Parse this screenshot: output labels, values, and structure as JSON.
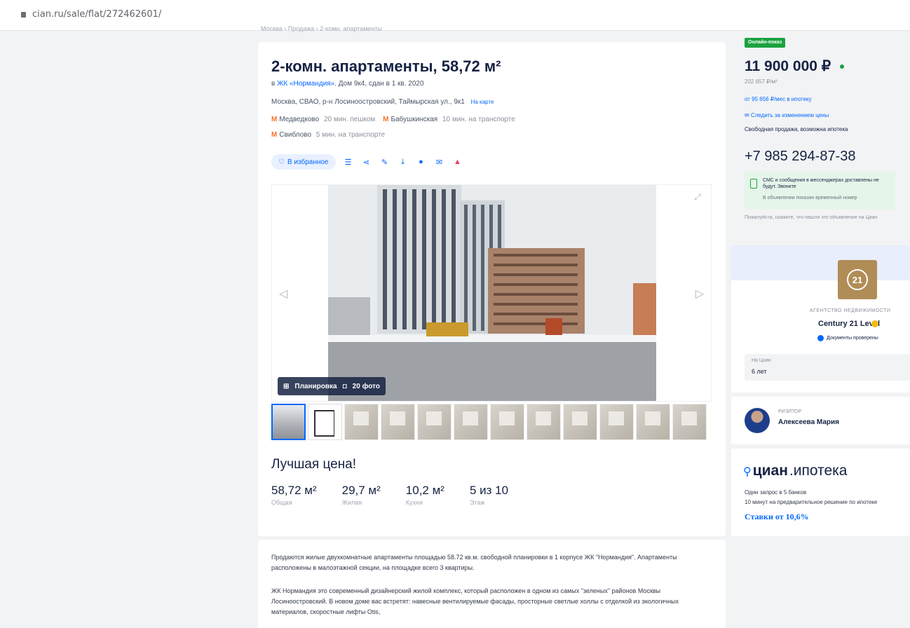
{
  "browser": {
    "url": "cian.ru/sale/flat/272462601/"
  },
  "breadcrumbs": "Москва › Продажа › 2-комн. апартаменты",
  "listing": {
    "title": "2-комн. апартаменты, 58,72 м²",
    "complex_prefix": "в ",
    "complex_link": "ЖК «Нормандия»",
    "complex_suffix": ". Дом 9к4, сдан в 1 кв. 2020",
    "address_text": "Москва, СВАО, р-н Лосиноостровский, Таймырская ул., 9к1",
    "map_link": "На карте",
    "metro": [
      {
        "icon": "metro-icon",
        "name": "Медведково",
        "distance": "20 мин. пешком"
      },
      {
        "icon": "metro-icon",
        "name": "Бабушкинская",
        "distance": "10 мин. на транспорте"
      },
      {
        "icon": "metro-icon",
        "name": "Свиблово",
        "distance": "5 мин. на транспорте"
      }
    ],
    "favorite_label": "В избранное",
    "gallery": {
      "layout_label": "Планировка",
      "photos_label": "20 фото",
      "thumb_count": 12
    },
    "best_price": "Лучшая цена!",
    "specs": [
      {
        "value": "58,72 м²",
        "label": "Общая"
      },
      {
        "value": "29,7 м²",
        "label": "Жилая"
      },
      {
        "value": "10,2 м²",
        "label": "Кухня"
      },
      {
        "value": "5 из 10",
        "label": "Этаж"
      }
    ]
  },
  "description": {
    "p1": "Продаются жилые двухкомнатные апартаменты площадью 58.72 кв.м. свободной планировки в 1 корпусе ЖК \"Нормандия\". Апартаменты расположены в малоэтажной секции, на площадке всего 3 квартиры.",
    "p2": "ЖК Нормандия это современный дизайнерский жилой комплекс, который расположен в одном из самых \"зеленых\" районов Москвы Лосиноостровский. В новом доме вас встретят: навесные вентилируемые фасады, просторные светлые холлы с отделкой из экологичных материалов, скоростные лифты Otis,"
  },
  "aside": {
    "online_badge": "Онлайн-показ",
    "price": "11 900 000 ₽",
    "price_per_m": "202 657 ₽/м²",
    "mortgage_link": "от 95 656 ₽/мес в ипотеку",
    "subscribe_link": "Следить за изменением цены",
    "sale_type": "Свободная продажа, возможна ипотека",
    "phone": "+7 985 294-87-38",
    "sms_title": "СМС и сообщения в мессенджерах доставлены не будут. Звоните",
    "sms_sub": "В объявлении показан временный номер",
    "hint": "Пожалуйста, скажите, что нашли это объявление на Циан",
    "agency_type": "АГЕНТСТВО НЕДВИЖИМОСТИ",
    "agency_name": "Century 21 Level",
    "docs_checked": "Документы проверены",
    "years_label": "На Циан",
    "years_value": "6 лет",
    "realtor_role": "РИЭЛТОР",
    "realtor_name": "Алексеева Мария",
    "ipoteka_brand_bold": "циан",
    "ipoteka_brand_thin": ".ипотека",
    "ipoteka_line1": "Один запрос в 5 банков",
    "ipoteka_line2": "10 минут на предварительное решение по ипотеке",
    "ipoteka_rate": "Ставки от 10,6%"
  },
  "colors": {
    "accent": "#0468ff",
    "metro": "#fd7028",
    "online": "#1aa33f",
    "agency": "#b08d57"
  }
}
